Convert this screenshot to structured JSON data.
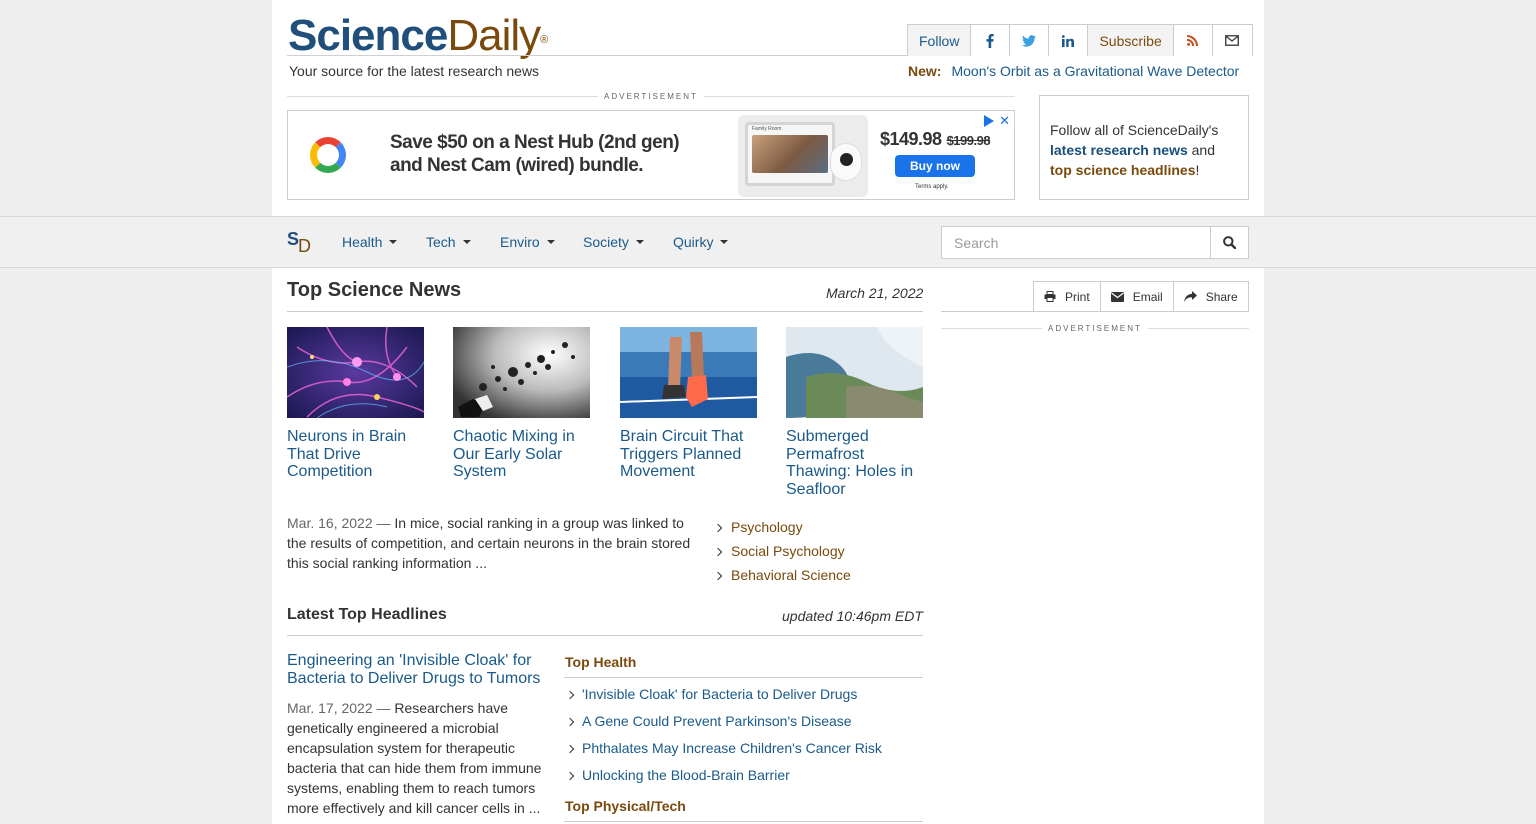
{
  "header": {
    "logo_science": "Science",
    "logo_daily": "Daily",
    "logo_reg": "®",
    "tagline": "Your source for the latest research news",
    "follow_label": "Follow",
    "subscribe_label": "Subscribe",
    "new_label": "New:",
    "new_link": "Moon's Orbit as a Gravitational Wave Detector"
  },
  "ad": {
    "label": "ADVERTISEMENT",
    "headline_line1": "Save $50 on a Nest Hub (2nd gen)",
    "headline_line2": "and Nest Cam (wired) bundle.",
    "price": "$149.98",
    "old_price": "$199.98",
    "button": "Buy now",
    "terms": "Terms apply.",
    "screen_caption": "Family Room"
  },
  "follow_box": {
    "text1": "Follow all of ScienceDaily's",
    "link1": "latest research news",
    "text2": " and",
    "link2": "top science headlines",
    "text3": "!"
  },
  "nav": {
    "logo_s": "S",
    "logo_d": "D",
    "items": [
      "Health",
      "Tech",
      "Enviro",
      "Society",
      "Quirky"
    ],
    "search_placeholder": "Search"
  },
  "top_news": {
    "heading": "Top Science News",
    "date": "March 21, 2022",
    "stories": [
      {
        "title": "Neurons in Brain That Drive Competition"
      },
      {
        "title": "Chaotic Mixing in Our Early Solar System"
      },
      {
        "title": "Brain Circuit That Triggers Planned Movement"
      },
      {
        "title": "Submerged Permafrost Thawing: Holes in Seafloor"
      }
    ],
    "summary_date": "Mar. 16, 2022",
    "summary_sep": " — ",
    "summary_text": "In mice, social ranking in a group was linked to the results of competition, and certain neurons in the brain stored this social ranking information ...",
    "topics": [
      "Psychology",
      "Social Psychology",
      "Behavioral Science"
    ]
  },
  "latest": {
    "heading": "Latest Top Headlines",
    "updated": "updated 10:46pm EDT",
    "lead_title": "Engineering an 'Invisible Cloak' for Bacteria to Deliver Drugs to Tumors",
    "lead_date": "Mar. 17, 2022",
    "lead_sep": " — ",
    "lead_text": "Researchers have genetically engineered a microbial encapsulation system for therapeutic bacteria that can hide them from immune systems, enabling them to reach tumors more effectively and kill cancer cells in ...",
    "top_health_heading": "Top Health",
    "top_health": [
      "'Invisible Cloak' for Bacteria to Deliver Drugs",
      "A Gene Could Prevent Parkinson's Disease",
      "Phthalates May Increase Children's Cancer Risk",
      "Unlocking the Blood-Brain Barrier"
    ],
    "top_physical_heading": "Top Physical/Tech"
  },
  "share": {
    "print": "Print",
    "email": "Email",
    "share": "Share",
    "ad_label": "ADVERTISEMENT"
  },
  "colors": {
    "link_blue": "#1a5a8a",
    "brand_brown": "#7a4a0c",
    "logo_blue": "#1f4f7a"
  }
}
